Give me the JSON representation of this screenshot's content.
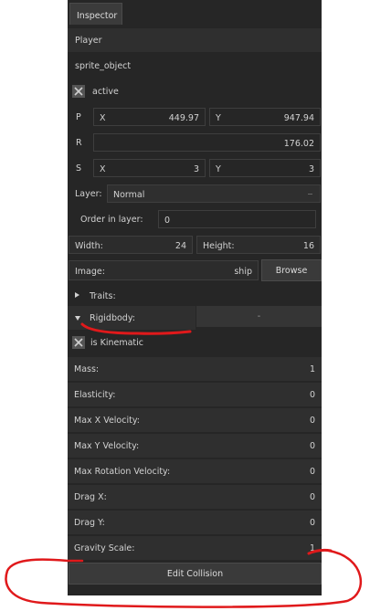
{
  "inspector": {
    "tab_label": "Inspector",
    "object_name": "Player",
    "sprite_label": "sprite_object",
    "active_label": "active",
    "position": {
      "label": "P",
      "x_label": "X",
      "x_value": "449.97",
      "y_label": "Y",
      "y_value": "947.94"
    },
    "rotation": {
      "label": "R",
      "value": "176.02"
    },
    "scale": {
      "label": "S",
      "x_label": "X",
      "x_value": "3",
      "y_label": "Y",
      "y_value": "3"
    },
    "layer": {
      "label": "Layer:",
      "value": "Normal"
    },
    "order": {
      "label": "Order in layer:",
      "value": "0"
    },
    "size": {
      "width_label": "Width:",
      "width_value": "24",
      "height_label": "Height:",
      "height_value": "16"
    },
    "image": {
      "label": "Image:",
      "value": "ship",
      "browse_label": "Browse"
    },
    "traits_label": "Traits:",
    "rigidbody": {
      "label": "Rigidbody:",
      "dropdown_value": "-"
    },
    "kinematic_label": "is Kinematic",
    "properties": [
      {
        "label": "Mass:",
        "value": "1"
      },
      {
        "label": "Elasticity:",
        "value": "0"
      },
      {
        "label": "Max X Velocity:",
        "value": "0"
      },
      {
        "label": "Max Y Velocity:",
        "value": "0"
      },
      {
        "label": "Max Rotation Velocity:",
        "value": "0"
      },
      {
        "label": "Drag X:",
        "value": "0"
      },
      {
        "label": "Drag Y:",
        "value": "0"
      },
      {
        "label": "Gravity Scale:",
        "value": "1"
      }
    ],
    "edit_collision_label": "Edit Collision"
  },
  "colors": {
    "panel": "#262626",
    "row": "#2f2f2f",
    "annotation": "#e0191b"
  }
}
